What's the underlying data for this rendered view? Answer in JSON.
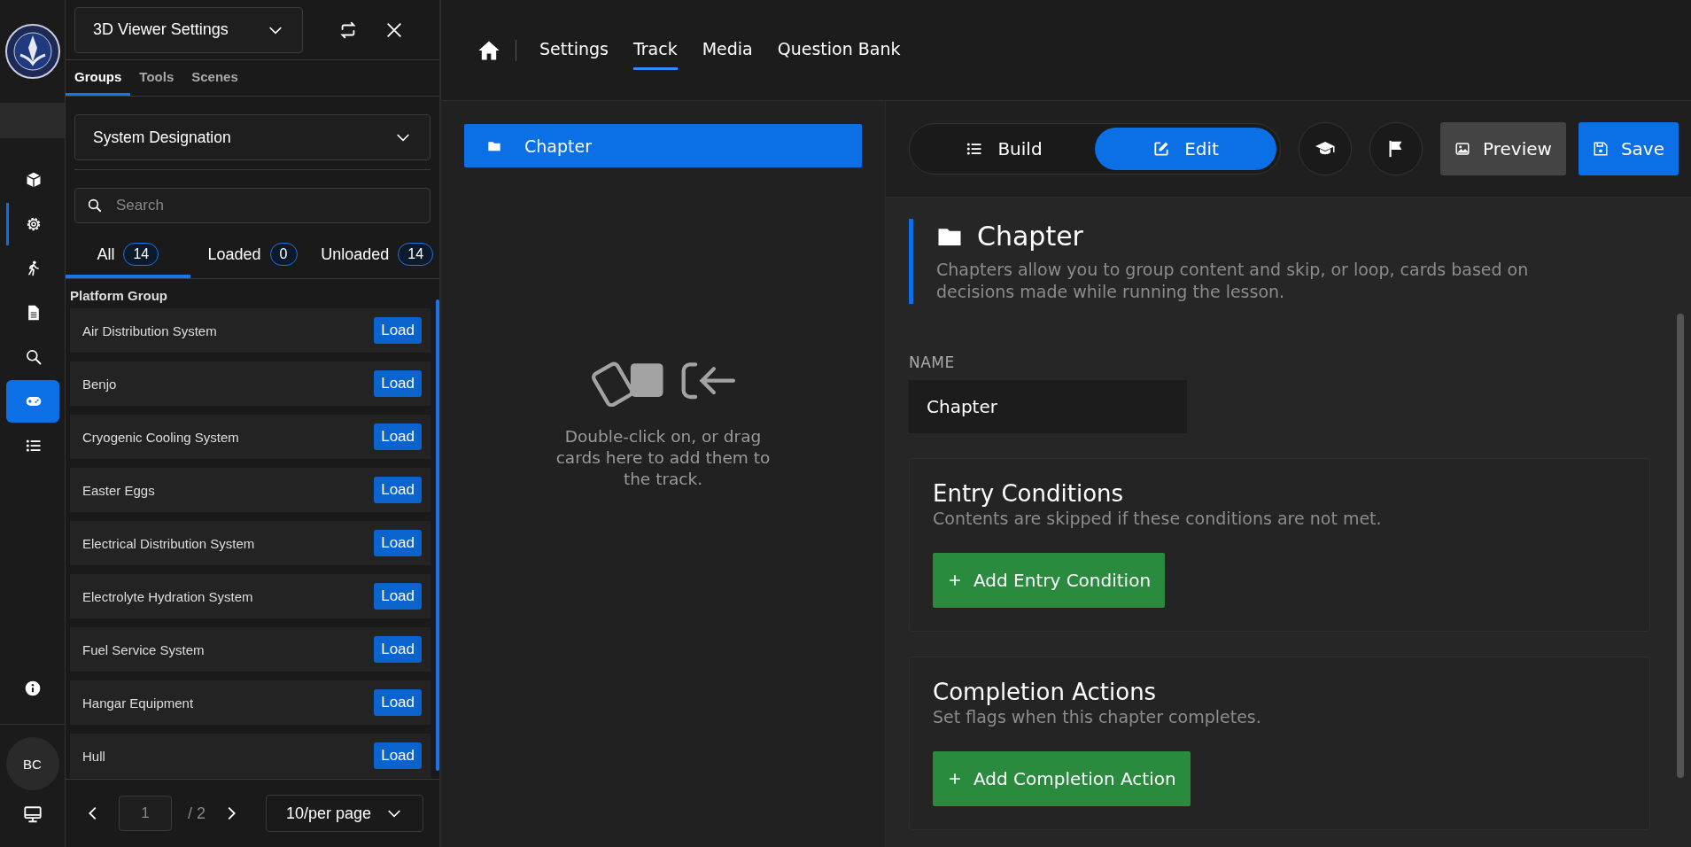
{
  "rail": {
    "items": [
      {
        "selected": false,
        "marked": false
      },
      {
        "selected": false,
        "marked": true
      },
      {
        "selected": false,
        "marked": false
      },
      {
        "selected": false,
        "marked": false
      },
      {
        "selected": false,
        "marked": false
      },
      {
        "selected": true,
        "marked": false
      },
      {
        "selected": false,
        "marked": false
      }
    ],
    "avatar": "BC"
  },
  "panel": {
    "title": "3D Viewer Settings",
    "tabs": [
      {
        "label": "Groups",
        "selected": true
      },
      {
        "label": "Tools",
        "selected": false
      },
      {
        "label": "Scenes",
        "selected": false
      }
    ],
    "group_select": "System Designation",
    "search": {
      "placeholder": "Search"
    },
    "filters": [
      {
        "label": "All",
        "count": "14",
        "selected": true
      },
      {
        "label": "Loaded",
        "count": "0",
        "selected": false
      },
      {
        "label": "Unloaded",
        "count": "14",
        "selected": false
      }
    ],
    "section": "Platform Group",
    "items": [
      {
        "name": "Air Distribution System",
        "action": "Load"
      },
      {
        "name": "Benjo",
        "action": "Load"
      },
      {
        "name": "Cryogenic Cooling System",
        "action": "Load"
      },
      {
        "name": "Easter Eggs",
        "action": "Load"
      },
      {
        "name": "Electrical Distribution System",
        "action": "Load"
      },
      {
        "name": "Electrolyte Hydration System",
        "action": "Load"
      },
      {
        "name": "Fuel Service System",
        "action": "Load"
      },
      {
        "name": "Hangar Equipment",
        "action": "Load"
      },
      {
        "name": "Hull",
        "action": "Load"
      }
    ],
    "pagination": {
      "page": "1",
      "total": "/ 2",
      "per_page": "10/per page"
    }
  },
  "nav": {
    "tabs": [
      {
        "label": "Settings",
        "selected": false
      },
      {
        "label": "Track",
        "selected": true
      },
      {
        "label": "Media",
        "selected": false
      },
      {
        "label": "Question Bank",
        "selected": false
      }
    ]
  },
  "track": {
    "chapter": {
      "label": "Chapter",
      "selected": true
    },
    "hint": "Double-click on, or drag cards here to add them to the track."
  },
  "mode_toggle": [
    {
      "label": "Build",
      "selected": false
    },
    {
      "label": "Edit",
      "selected": true
    }
  ],
  "actions": [
    {
      "label": "Preview",
      "kind": "secondary"
    },
    {
      "label": "Save",
      "kind": "primary"
    }
  ],
  "editor": {
    "title": "Chapter",
    "description": "Chapters allow you to group content and skip, or loop, cards based on decisions made while running the lesson.",
    "name_label": "NAME",
    "name_value": "Chapter",
    "sections": [
      {
        "title": "Entry Conditions",
        "subtitle": "Contents are skipped if these conditions are not met.",
        "button": "Add Entry Condition"
      },
      {
        "title": "Completion Actions",
        "subtitle": "Set flags when this chapter completes.",
        "button": "Add Completion Action"
      }
    ]
  }
}
